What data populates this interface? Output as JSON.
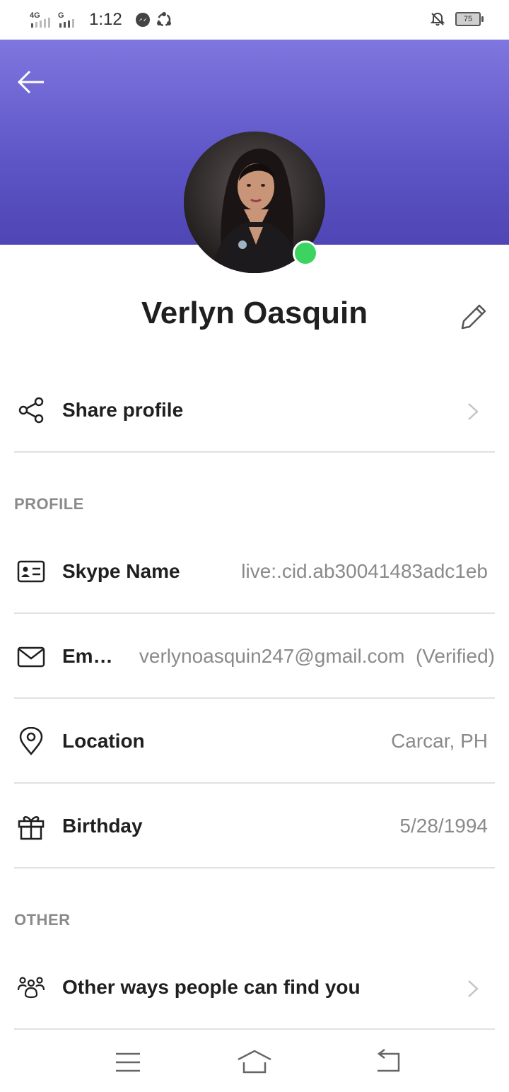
{
  "status_bar": {
    "time": "1:12",
    "network1": "4G",
    "network2": "G",
    "battery": "75",
    "icons": [
      "signal-icon",
      "messenger-icon",
      "sync-icon",
      "notifications-off-icon",
      "battery-icon"
    ]
  },
  "header": {
    "back_icon": "arrow-left-icon",
    "gradient_colors": [
      "#7f76df",
      "#4f45b4"
    ],
    "presence_color": "#3bd460"
  },
  "profile": {
    "name": "Verlyn Oasquin",
    "edit_icon": "pencil-icon"
  },
  "share": {
    "label": "Share profile",
    "icon": "share-icon"
  },
  "sections": {
    "profile": "PROFILE",
    "other": "OTHER"
  },
  "profile_rows": [
    {
      "label": "Skype Name",
      "value": "live:.cid.ab30041483adc1eb",
      "icon": "id-card-icon"
    },
    {
      "label": "Em…",
      "value": "verlynoasquin247@gmail.com  (Verified)",
      "icon": "mail-icon"
    },
    {
      "label": "Location",
      "value": "Carcar, PH",
      "icon": "location-pin-icon"
    },
    {
      "label": "Birthday",
      "value": "5/28/1994",
      "icon": "gift-icon"
    }
  ],
  "other": {
    "label": "Other ways people can find you",
    "icon": "people-group-icon"
  },
  "nav": {
    "icons": [
      "menu-icon",
      "home-icon",
      "back-icon"
    ]
  }
}
